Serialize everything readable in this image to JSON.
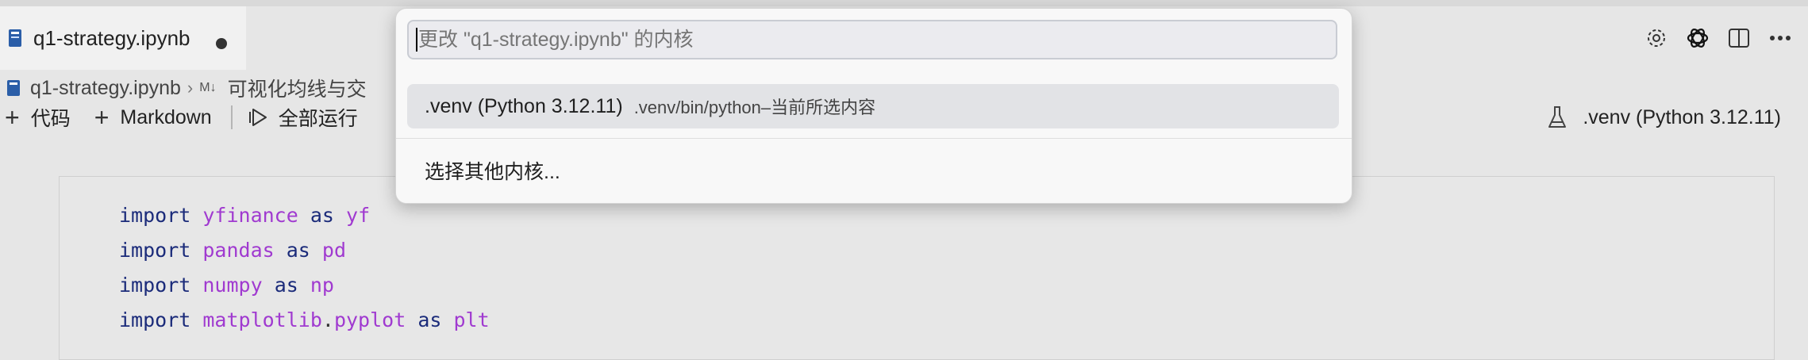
{
  "tab": {
    "filename": "q1-strategy.ipynb",
    "dirty": true
  },
  "breadcrumb": {
    "file": "q1-strategy.ipynb",
    "md_marker": "M↓",
    "section": "可视化均线与交"
  },
  "toolbar": {
    "add_code": "代码",
    "add_markdown": "Markdown",
    "run_all": "全部运行"
  },
  "kernel_indicator": {
    "label": ".venv (Python 3.12.11)"
  },
  "top_actions": [
    "gear-icon",
    "openai-icon",
    "split-editor-icon",
    "more-icon"
  ],
  "picker": {
    "placeholder": "更改 \"q1-strategy.ipynb\" 的内核",
    "selected_option": {
      "label": ".venv (Python 3.12.11)",
      "description": ".venv/bin/python–当前所选内容"
    },
    "other_option": "选择其他内核..."
  },
  "code": {
    "lines": [
      {
        "kw": "import",
        "module": "yfinance",
        "as": "as",
        "alias": "yf"
      },
      {
        "kw": "import",
        "module": "pandas",
        "as": "as",
        "alias": "pd"
      },
      {
        "kw": "import",
        "module": "numpy",
        "as": "as",
        "alias": "np"
      },
      {
        "kw": "import",
        "module": "matplotlib",
        "dot": ".",
        "sub": "pyplot",
        "as": "as",
        "alias": "plt"
      }
    ]
  },
  "colors": {
    "keyword": "#1b2b7a",
    "module": "#a03ad0",
    "accent": "#2b5ea8"
  }
}
